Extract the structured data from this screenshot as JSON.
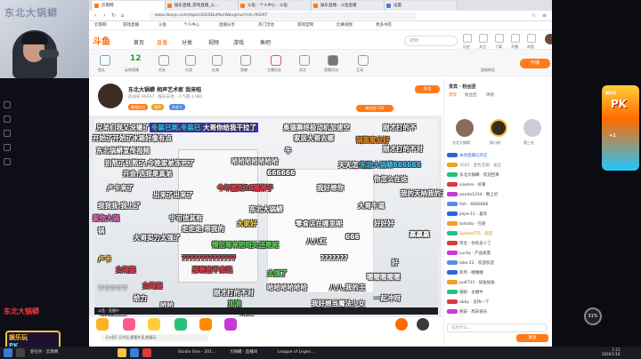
{
  "webcam": {
    "overlay_title": "东北大锅蟒"
  },
  "browser": {
    "tabs": [
      {
        "label": "云南网"
      },
      {
        "label": "娱乐直播_游戏直播_火..."
      },
      {
        "label": "斗鱼 - 个人中心 - 斗鱼"
      },
      {
        "label": "娱乐直播 - 斗鱼直播"
      },
      {
        "label": "设置"
      }
    ],
    "url": "www.douyu.com/topic/2020DuManWangHuo?rid=99297",
    "bookmarks": [
      "云南网",
      "游戏直播",
      "斗鱼",
      "个人中心",
      "直播分享",
      "热门活动",
      "游戏官网",
      "比赛视频",
      "更多书签"
    ]
  },
  "site": {
    "logo": "斗鱼",
    "menu": [
      "首页",
      "直播",
      "分类",
      "视频",
      "游戏",
      "鱼吧"
    ],
    "search_placeholder": "搜索",
    "top_icons": [
      {
        "label": "历史"
      },
      {
        "label": "关注"
      },
      {
        "label": "下载"
      },
      {
        "label": "开播"
      },
      {
        "label": "消息"
      }
    ]
  },
  "categories": {
    "level_num": "12",
    "labels": [
      "鱼丸",
      "云南直播",
      "任务",
      "分类",
      "礼物",
      "鱼粮",
      "主播任务",
      "关注",
      "直播活动",
      "互动",
      "超级粉丝"
    ],
    "open_live": "开播"
  },
  "room": {
    "title": "东北大锅蟒 相声艺术家 我来啦",
    "meta": "房间号 99297 · 娱乐天地 · 人气值 3,982",
    "tags": [
      "颜值担当",
      "相声",
      "东北人"
    ],
    "follow": "关注",
    "fans_badge": "粉丝团 156",
    "player_controls_label": "斗鱼 · 直播中",
    "bottom_input": "【斗鱼】天冷后,看看外面,超级玩"
  },
  "danmaku": [
    {
      "text": "兄弟们我又没辙了",
      "cls": "c6"
    },
    {
      "text": "冬装已到,冬装已到",
      "cls": "c2 hl"
    },
    {
      "text": "大哥你给我干拉了",
      "cls": "c6 hl"
    },
    {
      "text": "奥德赛终极动机加速空",
      "cls": "c6"
    },
    {
      "text": "刚才打的不",
      "cls": "c6"
    },
    {
      "text": "开始了开始了",
      "cls": "c6"
    },
    {
      "text": "冰箱好像有点",
      "cls": "c6"
    },
    {
      "text": "家居大哥去哪",
      "cls": "c6"
    },
    {
      "text": "锅盔家业好",
      "cls": "c7"
    },
    {
      "text": "东北锅蟒宣传视频",
      "cls": "c6"
    },
    {
      "text": "别熬了别熬了,今晚家被冻死了",
      "cls": "c6"
    },
    {
      "text": "哈哈哈哈哈哈哈",
      "cls": "c6"
    },
    {
      "text": "今年要到16路牌子",
      "cls": "c1"
    },
    {
      "text": "牛",
      "cls": "c6"
    },
    {
      "text": "开会,选我是真弟",
      "cls": "c6"
    },
    {
      "text": "出来了出来了",
      "cls": "c6"
    },
    {
      "text": "东北大锅蟒",
      "cls": "c6"
    },
    {
      "text": "零食店在哪里呢",
      "cls": "c6"
    },
    {
      "text": "大家好",
      "cls": "c3"
    },
    {
      "text": "情侣哥来把呀头还是呢",
      "cls": "c4"
    },
    {
      "text": "??????????????",
      "cls": "c1"
    },
    {
      "text": "那是他不会玩",
      "cls": "c1"
    },
    {
      "text": "女海盗",
      "cls": "c1"
    },
    {
      "text": "卢卡",
      "cls": "c3"
    },
    {
      "text": "???????",
      "cls": "c6"
    },
    {
      "text": "八八红",
      "cls": "c6"
    },
    {
      "text": "天天怎么打",
      "cls": "c6"
    },
    {
      "text": "你怎么在这",
      "cls": "c6"
    },
    {
      "text": "我的天呐我的天",
      "cls": "c6"
    },
    {
      "text": "我我我,我上了",
      "cls": "c6"
    },
    {
      "text": "刚才打的不对",
      "cls": "c6"
    },
    {
      "text": "加油",
      "cls": "c4"
    },
    {
      "text": "喔喔喔喔喔",
      "cls": "c6"
    },
    {
      "text": "哈哈哈哈哈哈",
      "cls": "c6"
    },
    {
      "text": "♡♡♡♡♡",
      "cls": "c6"
    },
    {
      "text": "女海盗",
      "cls": "c1"
    },
    {
      "text": "八八,我的王",
      "cls": "c6"
    },
    {
      "text": "一起冲呀",
      "cls": "c6"
    },
    {
      "text": "爱你大锅",
      "cls": "c5"
    },
    {
      "text": "锅",
      "cls": "c6"
    },
    {
      "text": "大哥实力太强了",
      "cls": "c6"
    },
    {
      "text": "宁可信其有",
      "cls": "c6"
    },
    {
      "text": "走走走,带我的",
      "cls": "c6"
    },
    {
      "text": "好好好",
      "cls": "c6"
    },
    {
      "text": "666666",
      "cls": "c6"
    },
    {
      "text": "卢卡来了",
      "cls": "c6"
    },
    {
      "text": "我好想你",
      "cls": "c6"
    },
    {
      "text": "大哥牛逼",
      "cls": "c6"
    },
    {
      "text": "刚才打的不对",
      "cls": "c6"
    },
    {
      "text": "东北大锅蟒666666",
      "cls": "c2"
    },
    {
      "text": "我好想当魔法少女",
      "cls": "c6"
    },
    {
      "text": "哈哈",
      "cls": "c6"
    },
    {
      "text": "网红",
      "cls": "c6"
    },
    {
      "text": "唧唧歪歪",
      "cls": "c6"
    },
    {
      "text": "给力",
      "cls": "c6"
    },
    {
      "text": "太强了",
      "cls": "c4"
    },
    {
      "text": "好",
      "cls": "c6"
    },
    {
      "text": "666",
      "cls": "c6"
    },
    {
      "text": "赢赢赢",
      "cls": "c6"
    }
  ],
  "right_panel": {
    "rank_title": "贵宾 · 粉丝团",
    "tabs": [
      "贵宾",
      "粉丝团",
      "周榜"
    ],
    "ranks": [
      {
        "name": "东北大锅蟒"
      },
      {
        "name": "锅小粉"
      },
      {
        "name": "第三名"
      }
    ],
    "chat": [
      {
        "text": "本场直播已开启",
        "color": "#2a66d9"
      },
      {
        "text": "2020 · 金色宝箱 · 送出",
        "color": "#888"
      },
      {
        "text": "东北大锅蟒 · 欢迎回来",
        "color": "#444"
      },
      {
        "text": "xiaohei · 好看",
        "color": "#444"
      },
      {
        "text": "panda1234 · 晚上好",
        "color": "#444"
      },
      {
        "text": "fish · 6666666",
        "color": "#444"
      },
      {
        "text": "jiejie-11 · 喜欢",
        "color": "#444"
      },
      {
        "text": "tomato · 在呢",
        "color": "#444"
      },
      {
        "text": "Sunset775 · 欢迎",
        "color": "#c08a00"
      },
      {
        "text": "鸡毛 · 你有多少了",
        "color": "#444"
      },
      {
        "text": "Lucky · 产品质量",
        "color": "#444"
      },
      {
        "text": "lake-22 · 欢迎欢迎",
        "color": "#444"
      },
      {
        "text": "阿月 · 喔喔喔",
        "color": "#444"
      },
      {
        "text": "pu6733 · 加油加油",
        "color": "#444"
      },
      {
        "text": "锅粉 · 主播牛",
        "color": "#444"
      },
      {
        "text": "abby · 支持一下",
        "color": "#444"
      },
      {
        "text": "晚安 · 周末快乐",
        "color": "#444"
      }
    ],
    "chat_placeholder": "说点什么...",
    "send": "发送"
  },
  "right_edge": {
    "pk_text": "PK",
    "pk_sub": "娱乐玩",
    "pk_num": "+1",
    "bubble": "31%"
  },
  "taskbar": {
    "items": [
      "新任务 · 云南网",
      "D:\\工作目录",
      "Studio One - 201...",
      "大锅蟒 · 直播间",
      "League of Legen..."
    ],
    "time": "1:21",
    "date": "2020/1/18"
  },
  "colors": {
    "accent": "#ff7a1a",
    "danmaku_red": "#ff3344",
    "danmaku_blue": "#33c4ff",
    "danmaku_green": "#52e052"
  }
}
